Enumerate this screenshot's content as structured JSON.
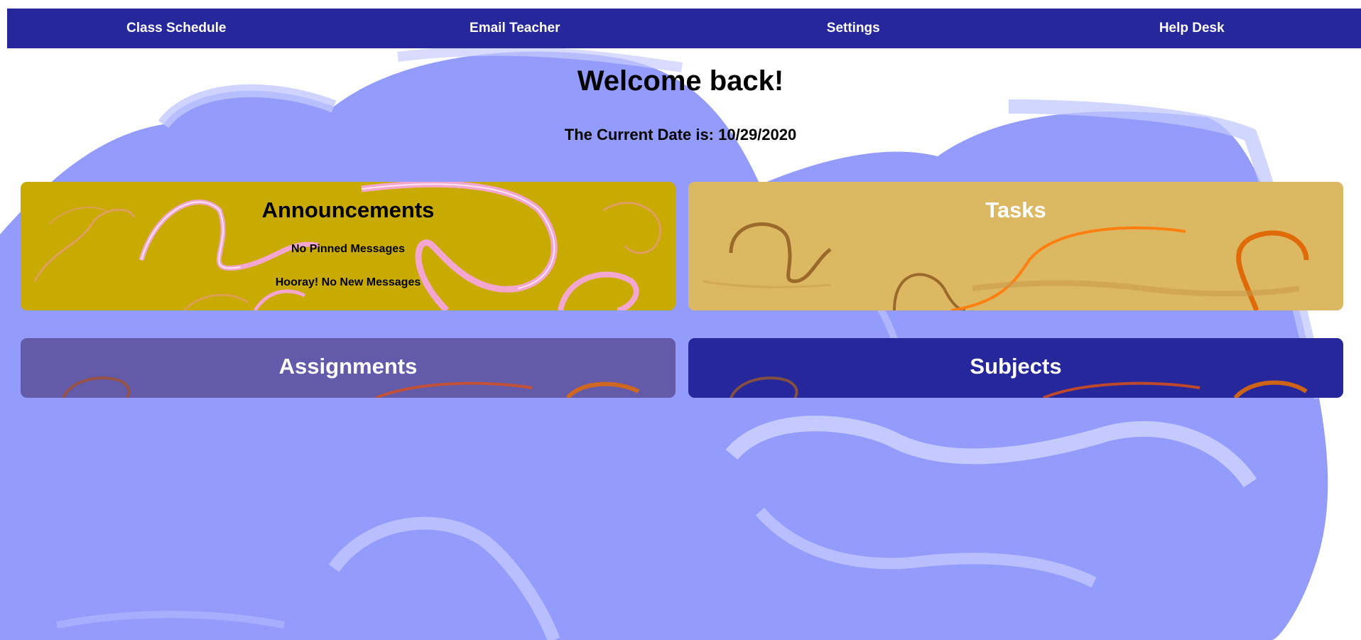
{
  "nav": {
    "items": [
      {
        "label": "Class Schedule"
      },
      {
        "label": "Email Teacher"
      },
      {
        "label": "Settings"
      },
      {
        "label": "Help Desk"
      }
    ]
  },
  "main": {
    "welcome": "Welcome back!",
    "date_line": "The Current Date is: 10/29/2020"
  },
  "cards": {
    "announcements": {
      "title": "Announcements",
      "pinned": "No Pinned Messages",
      "new_messages": "Hooray! No New Messages"
    },
    "tasks": {
      "title": "Tasks"
    },
    "assignments": {
      "title": "Assignments"
    },
    "subjects": {
      "title": "Subjects"
    }
  },
  "colors": {
    "nav_bg": "#25279a",
    "background_art": "#939cfb",
    "announcements_bg": "#c9aa00",
    "tasks_bg": "#dcb862",
    "assignments_bg": "#645aaa",
    "subjects_bg": "#25279a",
    "nav_text": "#ffffff"
  }
}
